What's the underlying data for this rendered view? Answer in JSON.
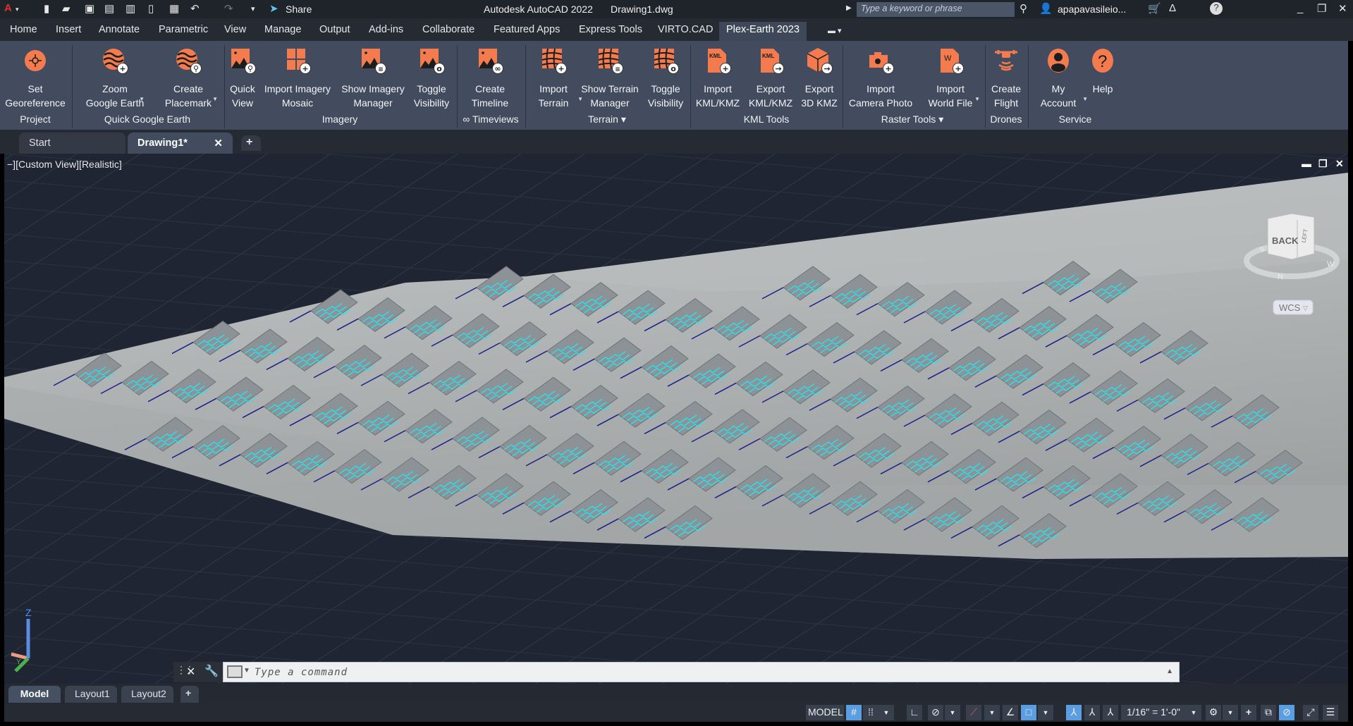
{
  "title_bar": {
    "app_menu": "A",
    "share": "Share",
    "title": "Autodesk AutoCAD 2022",
    "filename": "Drawing1.dwg",
    "search_placeholder": "Type a keyword or phrase",
    "user": "apapavasileio..."
  },
  "menu_tabs": [
    "Home",
    "Insert",
    "Annotate",
    "Parametric",
    "View",
    "Manage",
    "Output",
    "Add-ins",
    "Collaborate",
    "Featured Apps",
    "Express Tools",
    "VIRTO.CAD",
    "Plex-Earth 2023"
  ],
  "active_menu_tab": "Plex-Earth 2023",
  "ribbon": {
    "buttons": [
      {
        "label": "Set\nGeoreference",
        "icon": "georeference-icon"
      },
      {
        "label": "Zoom\nGoogle Earth",
        "icon": "globe-zoom-icon"
      },
      {
        "label": "Create\nPlacemark",
        "icon": "globe-placemark-icon"
      },
      {
        "label": "Quick\nView",
        "icon": "image-pin-icon"
      },
      {
        "label": "Import Imagery\nMosaic",
        "icon": "mosaic-add-icon"
      },
      {
        "label": "Show Imagery\nManager",
        "icon": "image-settings-icon"
      },
      {
        "label": "Toggle\nVisibility",
        "icon": "image-visibility-icon"
      },
      {
        "label": "Create\nTimeline",
        "icon": "image-timeline-icon"
      },
      {
        "label": "Import\nTerrain",
        "icon": "terrain-add-icon"
      },
      {
        "label": "Show Terrain\nManager",
        "icon": "terrain-settings-icon"
      },
      {
        "label": "Toggle\nVisibility",
        "icon": "terrain-visibility-icon"
      },
      {
        "label": "Import\nKML/KMZ",
        "icon": "kml-import-icon"
      },
      {
        "label": "Export\nKML/KMZ",
        "icon": "kml-export-icon"
      },
      {
        "label": "Export\n3D KMZ",
        "icon": "cube-export-icon"
      },
      {
        "label": "Import\nCamera Photo",
        "icon": "camera-add-icon"
      },
      {
        "label": "Import\nWorld File",
        "icon": "world-file-add-icon"
      },
      {
        "label": "Create\nFlight",
        "icon": "drone-icon"
      },
      {
        "label": "My\nAccount",
        "icon": "account-icon"
      },
      {
        "label": "Help",
        "icon": "help-icon"
      }
    ],
    "groups": [
      "Project",
      "Quick Google Earth",
      "Imagery",
      "∞ Timeviews",
      "Terrain ▾",
      "KML Tools",
      "Raster Tools ▾",
      "Drones",
      "Service"
    ]
  },
  "file_tabs": {
    "start": "Start",
    "drawing": "Drawing1*",
    "close": "✕",
    "new": "+"
  },
  "viewport": {
    "label": "−][Custom View][Realistic]",
    "viewcube_face": "BACK",
    "viewcube_side": "LEFT",
    "compass": [
      "S",
      "W",
      "N"
    ],
    "wcs": "WCS",
    "ucs_z": "Z",
    "ucs_y": "Y"
  },
  "command_line": {
    "placeholder": "Type a command"
  },
  "layout_tabs": [
    "Model",
    "Layout1",
    "Layout2"
  ],
  "layout_add": "+",
  "status_bar": {
    "model": "MODEL",
    "scale": "1/16\" = 1'-0\""
  },
  "colors": {
    "accent": "#f47b4e",
    "ribbon": "#434c5e",
    "active_toggle": "#5a9de0",
    "panel_line": "#22e6f2",
    "terrain": "#b0b3b3"
  }
}
